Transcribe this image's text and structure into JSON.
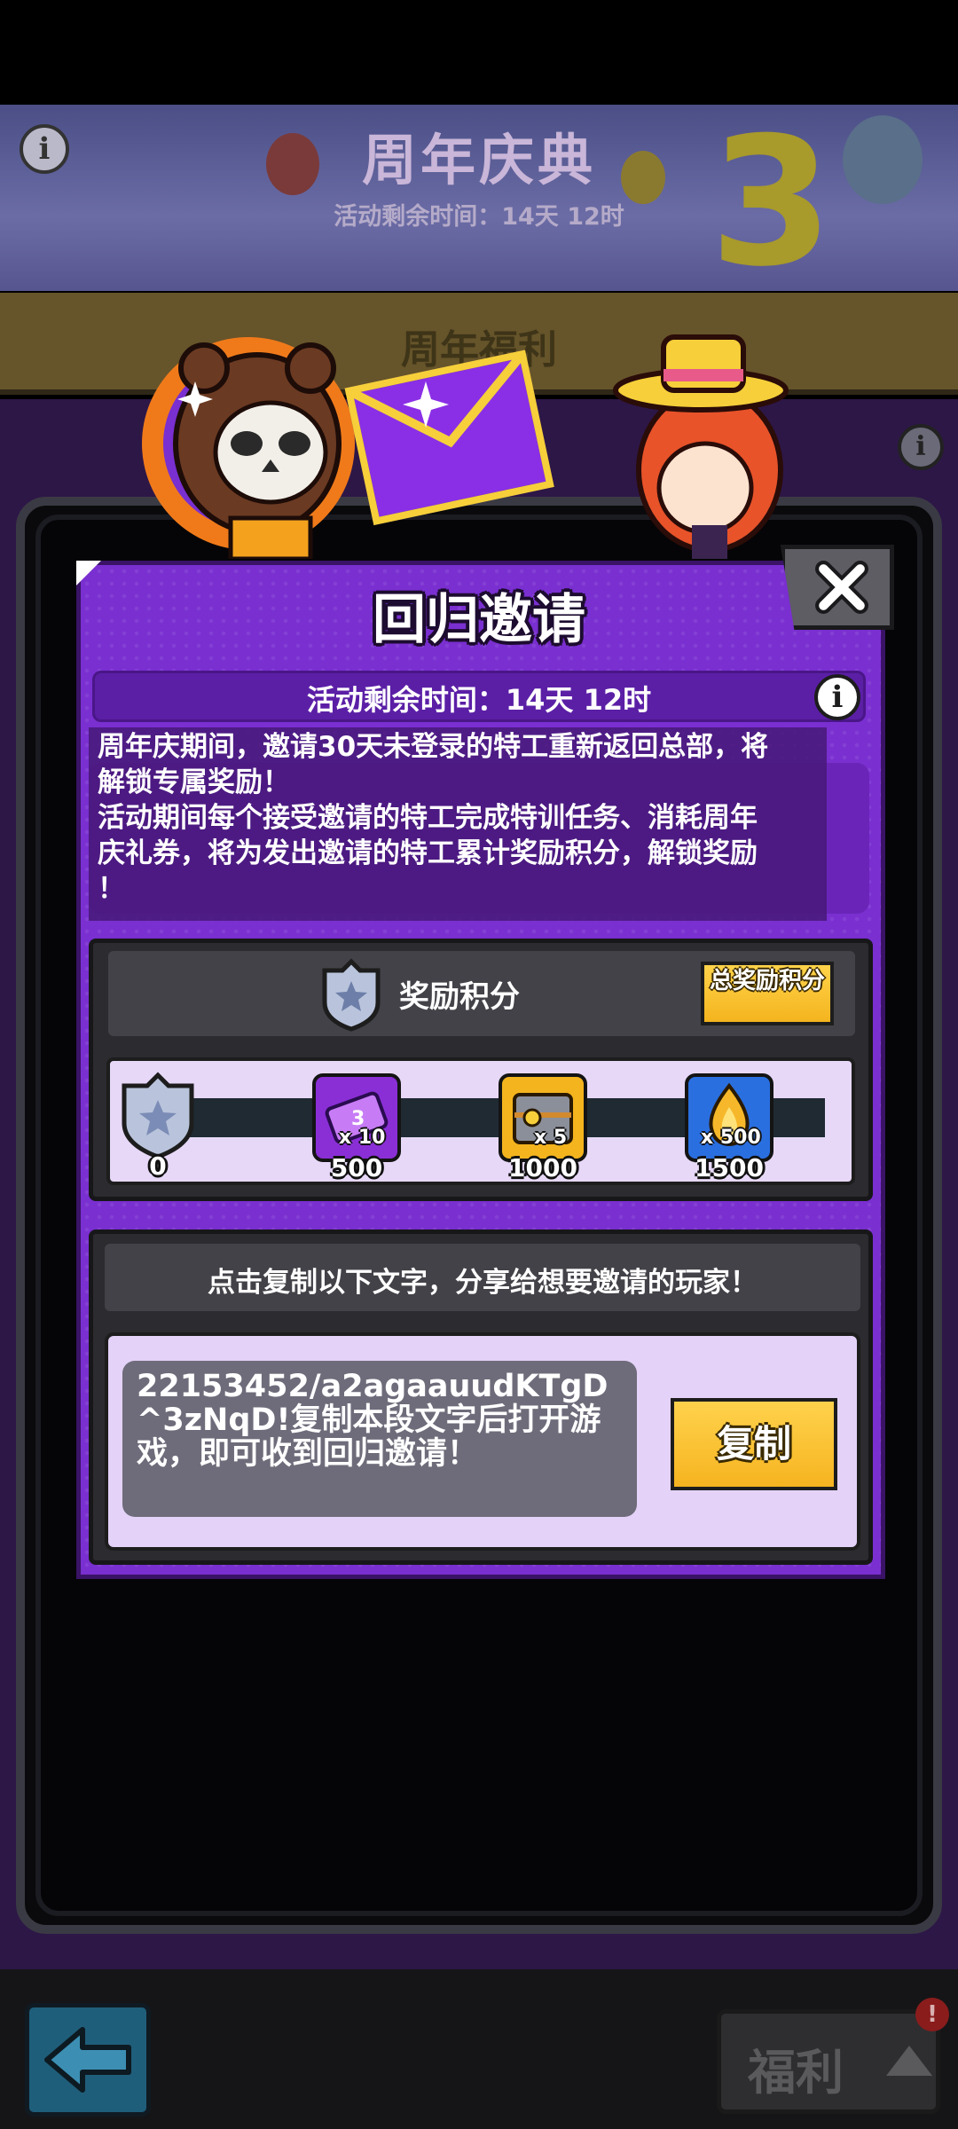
{
  "background": {
    "event_title": "周年庆典",
    "event_timer": "活动剩余时间：14天 12时",
    "anniversary_number": "3",
    "sub_tab": "周年福利",
    "footer_button": "福利",
    "footer_badge": "!"
  },
  "dialog": {
    "title": "回归邀请",
    "timer": "活动剩余时间：14天 12时",
    "description": "周年庆期间，邀请30天未登录的特工重新返回总部，将\n解锁专属奖励！\n活动期间每个接受邀请的特工完成特训任务、消耗周年\n庆礼券，将为发出邀请的特工累计奖励积分，解锁奖励\n！",
    "points": {
      "label": "奖励积分",
      "total_button": "总奖励积分",
      "current": 0,
      "progress_fraction": 0,
      "start_value": "0",
      "milestones": [
        {
          "value": "500",
          "count": "x 10",
          "reward_icon": "ticket-icon",
          "color": "#8a2fd6"
        },
        {
          "value": "1000",
          "count": "x 5",
          "reward_icon": "treasure-chest-icon",
          "color": "#f4b41e"
        },
        {
          "value": "1500",
          "count": "x 500",
          "reward_icon": "flame-drop-icon",
          "color": "#2a6fe0"
        }
      ]
    },
    "share": {
      "title": "点击复制以下文字，分享给想要邀请的玩家！",
      "code_text": "22153452/a2agaauudKTgD^3zNqD!复制本段文字后打开游戏，即可收到回归邀请！",
      "copy_button": "复制"
    }
  }
}
